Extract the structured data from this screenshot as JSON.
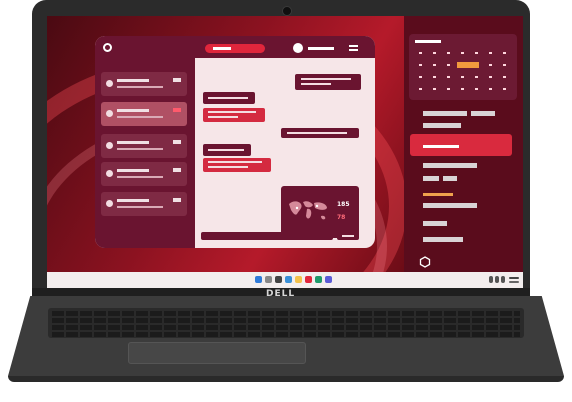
{
  "brand": {
    "logo_text": "DELL"
  },
  "desktop": {
    "accent_colors": {
      "primary": "#d92a3e",
      "dark": "#6a1430",
      "highlight": "#f29a3d"
    }
  },
  "chat_app": {
    "icons": {
      "logo": "ring-logo-icon",
      "menu": "hamburger-menu-icon",
      "avatar": "user-avatar-icon"
    },
    "conversations": [
      {
        "state": "default",
        "badge": "normal"
      },
      {
        "state": "active",
        "badge": "alert"
      },
      {
        "state": "default",
        "badge": "normal"
      },
      {
        "state": "default",
        "badge": "normal"
      },
      {
        "state": "default",
        "badge": "normal"
      }
    ],
    "map_card": {
      "stat_top": "185",
      "stat_bottom": "78"
    }
  },
  "taskbar": {
    "icons": [
      "windows-start-icon",
      "search-icon",
      "task-view-icon",
      "widgets-icon",
      "chat-icon",
      "file-explorer-icon",
      "edge-browser-icon",
      "store-icon"
    ],
    "tray_icons": [
      "wifi-icon",
      "volume-icon",
      "battery-icon"
    ]
  },
  "sidebar": {
    "icons": {
      "bottom": "hexagon-settings-icon"
    }
  }
}
